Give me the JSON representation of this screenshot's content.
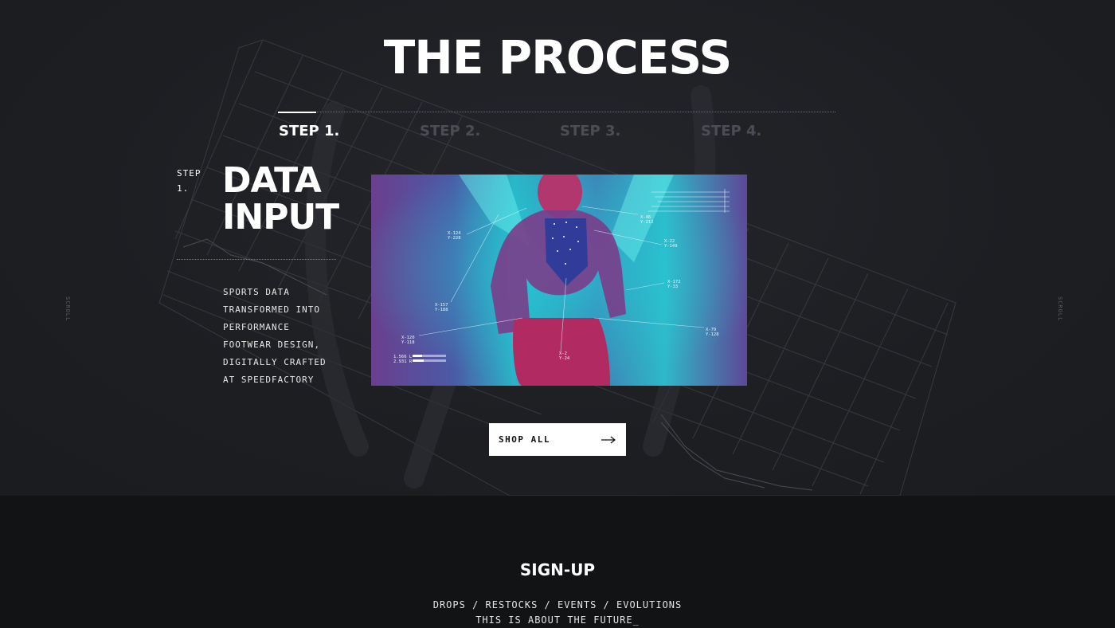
{
  "section_title": "THE PROCESS",
  "steps": [
    {
      "label": "STEP 1."
    },
    {
      "label": "STEP 2."
    },
    {
      "label": "STEP 3."
    },
    {
      "label": "STEP 4."
    }
  ],
  "active_step": {
    "number_label_line1": "STEP",
    "number_label_line2": "1.",
    "heading_line1": "DATA",
    "heading_line2": "INPUT",
    "description": [
      "SPORTS DATA",
      "TRANSFORMED INTO",
      "PERFORMANCE",
      "FOOTWEAR DESIGN,",
      "DIGITALLY CRAFTED",
      "AT SPEEDFACTORY"
    ]
  },
  "panel_annotations": [
    {
      "line1": "X-124",
      "line2": "Y-228"
    },
    {
      "line1": "X-46",
      "line2": "Y-212"
    },
    {
      "line1": "X-22",
      "line2": "Y-149"
    },
    {
      "line1": "X-157",
      "line2": "Y-188"
    },
    {
      "line1": "X-172",
      "line2": "Y-33"
    },
    {
      "line1": "X-120",
      "line2": "Y-118"
    },
    {
      "line1": "X-2",
      "line2": "Y-24"
    },
    {
      "line1": "X-79",
      "line2": "Y-128"
    }
  ],
  "panel_readouts": [
    "1.566 L",
    "2.931 R"
  ],
  "scroll_hint": "SCROLL",
  "shop_button": "SHOP ALL",
  "signup": {
    "title": "SIGN-UP",
    "line1": "DROPS / RESTOCKS / EVENTS / EVOLUTIONS",
    "line2": "THIS IS ABOUT THE FUTURE_"
  },
  "colors": {
    "background": "#1c1e22",
    "footer": "#121315",
    "inactive_step": "#4a4d54",
    "accent_cyan": "#2bb3c6",
    "accent_magenta": "#a8285f"
  }
}
